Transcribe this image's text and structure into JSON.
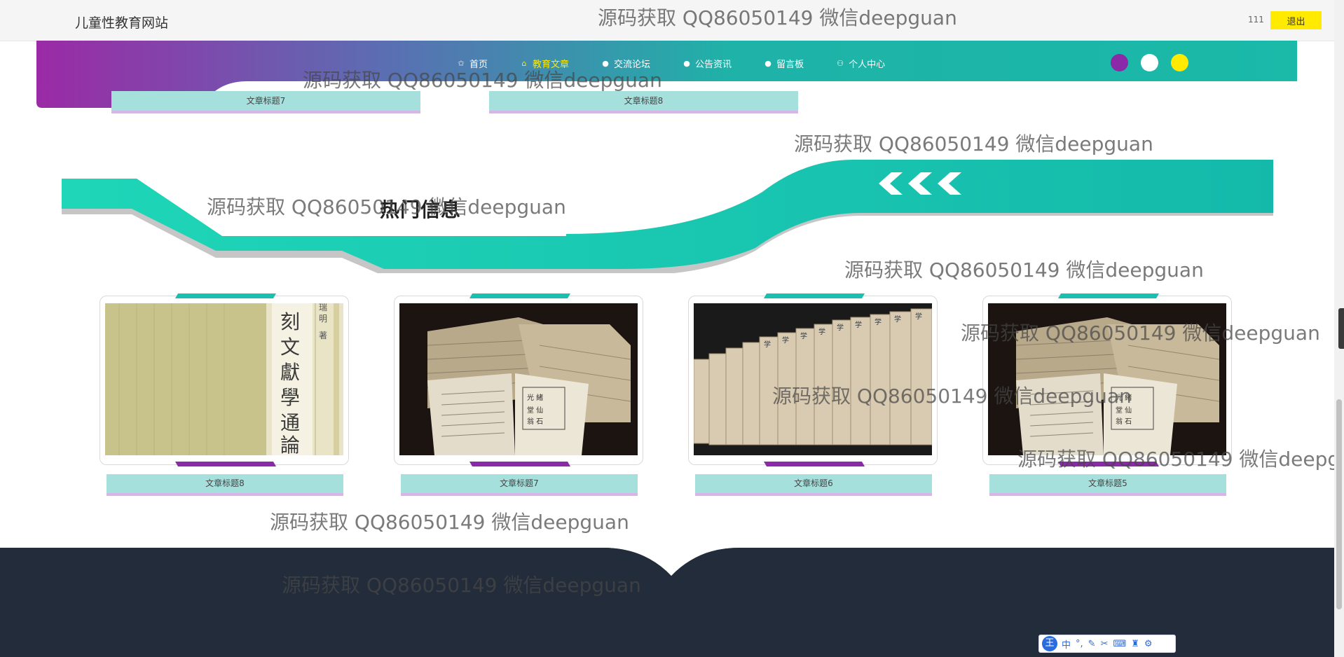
{
  "header": {
    "site_title": "儿童性教育网站",
    "username": "111",
    "logout_label": "退出"
  },
  "nav": {
    "items": [
      {
        "icon": "star-icon",
        "glyph": "✩",
        "label": "首页",
        "active": false
      },
      {
        "icon": "home-icon",
        "glyph": "⌂",
        "label": "教育文章",
        "active": true
      },
      {
        "icon": "info-icon",
        "glyph": "●",
        "label": "交流论坛",
        "active": false
      },
      {
        "icon": "info-icon",
        "glyph": "●",
        "label": "公告资讯",
        "active": false
      },
      {
        "icon": "help-icon",
        "glyph": "●",
        "label": "留言板",
        "active": false
      },
      {
        "icon": "user-icon",
        "glyph": "⚇",
        "label": "个人中心",
        "active": false
      }
    ],
    "theme_swatches": [
      "#8a2aa8",
      "#ffffff",
      "#ffea00"
    ]
  },
  "top_strips": [
    "文章标题7",
    "文章标题8"
  ],
  "hot_section": {
    "title": "热门信息"
  },
  "cards": [
    {
      "label": "文章标题8",
      "image": "book-cover-calligraphy"
    },
    {
      "label": "文章标题7",
      "image": "stacked-old-books"
    },
    {
      "label": "文章标题6",
      "image": "row-of-bound-books"
    },
    {
      "label": "文章标题5",
      "image": "stacked-old-books"
    }
  ],
  "watermark_text": "源码获取 QQ86050149 微信deepguan",
  "ime_bar": {
    "logo": "王",
    "lang": "中"
  },
  "colors": {
    "teal": "#1bbfb0",
    "purple": "#8a2aa8",
    "yellow": "#ffea00",
    "footer": "#232c3a"
  }
}
